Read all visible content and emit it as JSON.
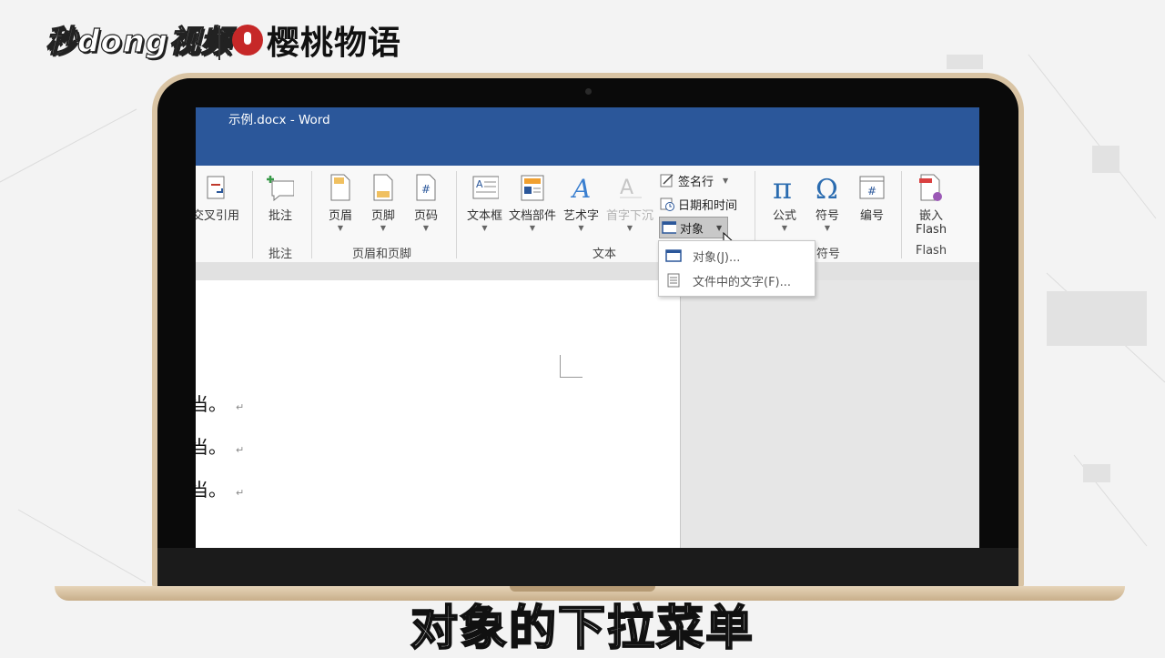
{
  "watermark": {
    "left_logo": "秒dong视频",
    "right_logo": "樱桃物语"
  },
  "window": {
    "title": "示例.docx  -  Word"
  },
  "ribbon": {
    "cross_ref": "交叉引用",
    "comment": "批注",
    "header": "页眉",
    "footer": "页脚",
    "page_number": "页码",
    "text_box": "文本框",
    "quick_parts": "文档部件",
    "wordart": "艺术字",
    "drop_cap": "首字下沉",
    "signature_line": "签名行",
    "date_time": "日期和时间",
    "object": "对象",
    "equation": "公式",
    "symbol": "符号",
    "numbering": "编号",
    "embed_flash_line1": "嵌入",
    "embed_flash_line2": "Flash"
  },
  "groups": {
    "comments": "批注",
    "header_footer": "页眉和页脚",
    "text": "文本",
    "symbols": "符号",
    "flash": "Flash"
  },
  "dropdown": {
    "items": [
      {
        "label": "对象(J)...",
        "icon": "object-icon"
      },
      {
        "label": "文件中的文字(F)...",
        "icon": "text-from-file-icon"
      }
    ]
  },
  "document": {
    "paragraphs": [
      "当。",
      "当。",
      "当。"
    ],
    "paragraph_mark": "↵"
  },
  "caption": "对象的下拉菜单",
  "colors": {
    "title_bar": "#2b579a",
    "laptop_frame": "#d9c4a4"
  }
}
